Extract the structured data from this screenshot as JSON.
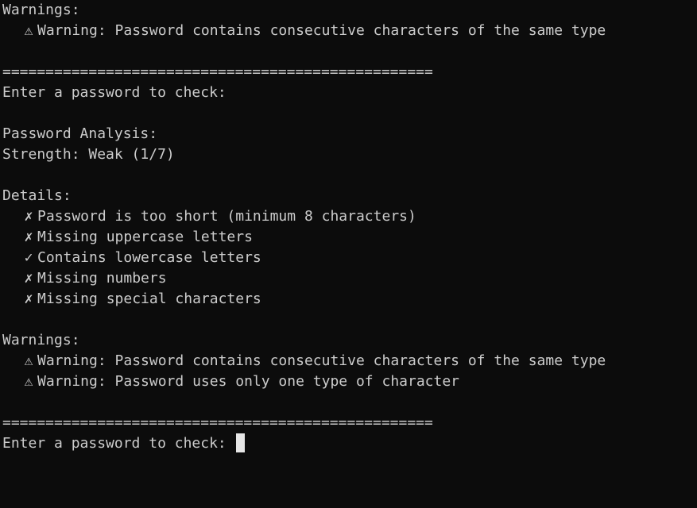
{
  "terminal": {
    "lines_top": {
      "warnings_header": "Warnings:",
      "warning_1": "Warning: Password contains consecutive characters of the same type"
    },
    "separator_1": "==================================================",
    "prompt_1": "Enter a password to check:",
    "analysis": {
      "title": "Password Analysis:",
      "strength": "Strength: Weak (1/7)",
      "details_header": "Details:",
      "details": [
        {
          "mark": "✗",
          "text": "Password is too short (minimum 8 characters)"
        },
        {
          "mark": "✗",
          "text": "Missing uppercase letters"
        },
        {
          "mark": "✓",
          "text": "Contains lowercase letters"
        },
        {
          "mark": "✗",
          "text": "Missing numbers"
        },
        {
          "mark": "✗",
          "text": "Missing special characters"
        }
      ],
      "warnings_header": "Warnings:",
      "warnings": [
        {
          "mark": "⚠",
          "text": "Warning: Password contains consecutive characters of the same type"
        },
        {
          "mark": "⚠",
          "text": "Warning: Password uses only one type of character"
        }
      ]
    },
    "separator_2": "==================================================",
    "prompt_2": "Enter a password to check: "
  }
}
